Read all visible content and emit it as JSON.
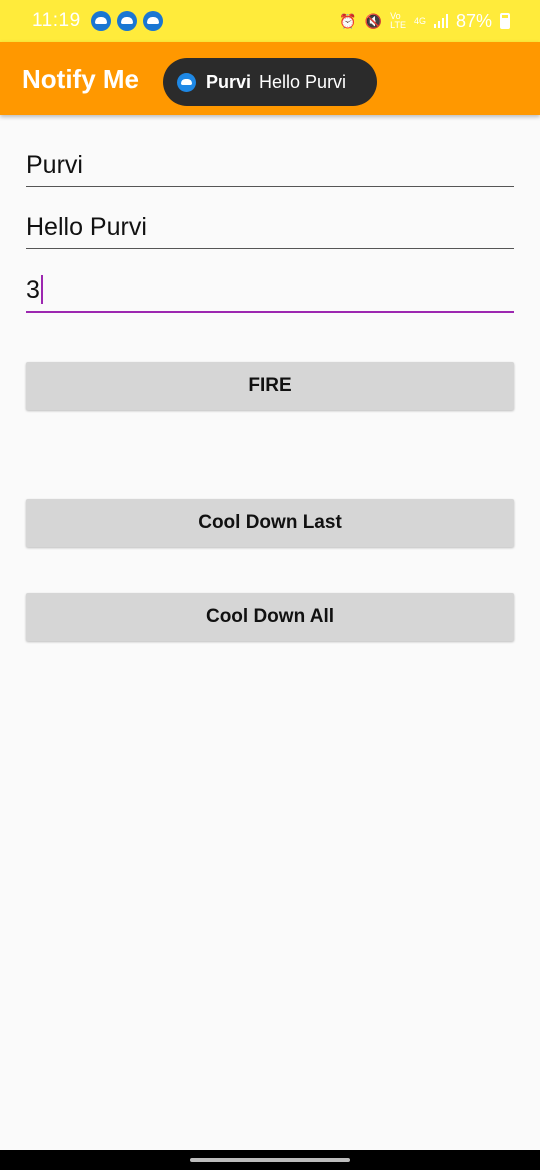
{
  "status_bar": {
    "time": "11:19",
    "notification_icons": [
      "app-icon",
      "app-icon",
      "app-icon"
    ],
    "battery": "87%",
    "background_color": "#ffeb3b"
  },
  "app_bar": {
    "title": "Notify Me",
    "background_color": "#ff9800"
  },
  "toast": {
    "title": "Purvi",
    "message": "Hello Purvi"
  },
  "form": {
    "title_value": "Purvi",
    "message_value": "Hello Purvi",
    "count_value": "3"
  },
  "buttons": {
    "fire": "FIRE",
    "cool_down_last": "Cool Down Last",
    "cool_down_all": "Cool Down All"
  },
  "colors": {
    "accent": "#9c27b0",
    "button_bg": "#d6d6d6"
  }
}
